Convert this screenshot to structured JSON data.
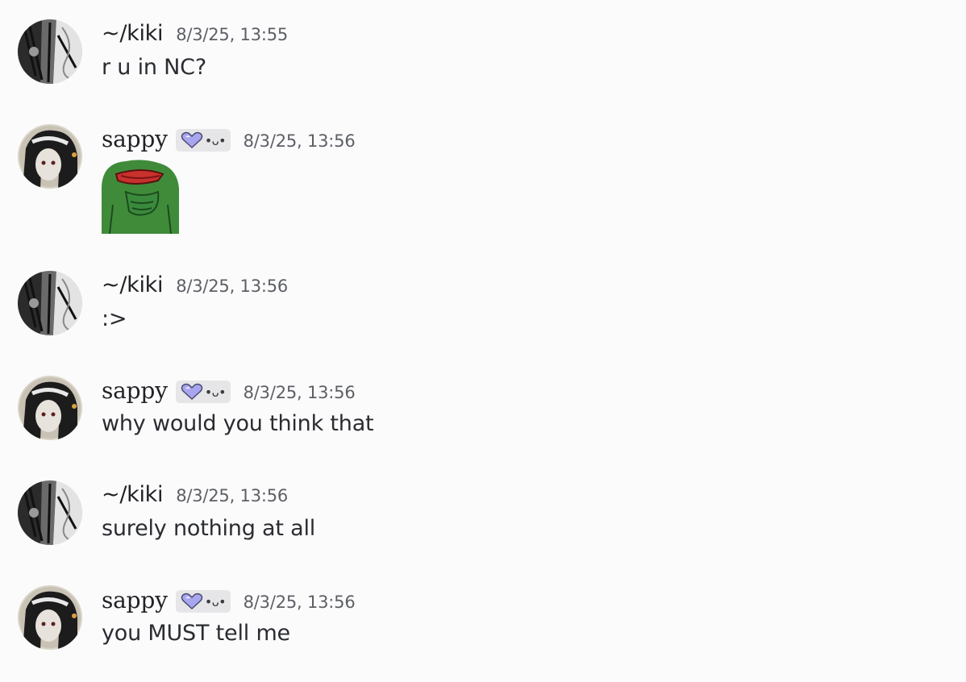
{
  "messages": [
    {
      "author": "~/kiki",
      "timestamp": "8/3/25, 13:55",
      "text": "r u in NC?"
    },
    {
      "author": "sappy",
      "tag_icon": "purple-heart-icon",
      "tag_text": "•ᴗ•",
      "timestamp": "8/3/25, 13:56",
      "attachment": "frog-emote-image"
    },
    {
      "author": "~/kiki",
      "timestamp": "8/3/25, 13:56",
      "text": ":>"
    },
    {
      "author": "sappy",
      "tag_icon": "purple-heart-icon",
      "tag_text": "•ᴗ•",
      "timestamp": "8/3/25, 13:56",
      "text": "why would you think that"
    },
    {
      "author": "~/kiki",
      "timestamp": "8/3/25, 13:56",
      "text": "surely nothing at all"
    },
    {
      "author": "sappy",
      "tag_icon": "purple-heart-icon",
      "tag_text": "•ᴗ•",
      "timestamp": "8/3/25, 13:56",
      "text": "you MUST tell me"
    }
  ],
  "colors": {
    "background": "#fbfbfb",
    "text": "#2a2c31",
    "timestamp": "#5d5f66",
    "tag_bg": "#e6e6e8",
    "heart": "#a9a6f0",
    "frog": "#3a8a3c"
  }
}
